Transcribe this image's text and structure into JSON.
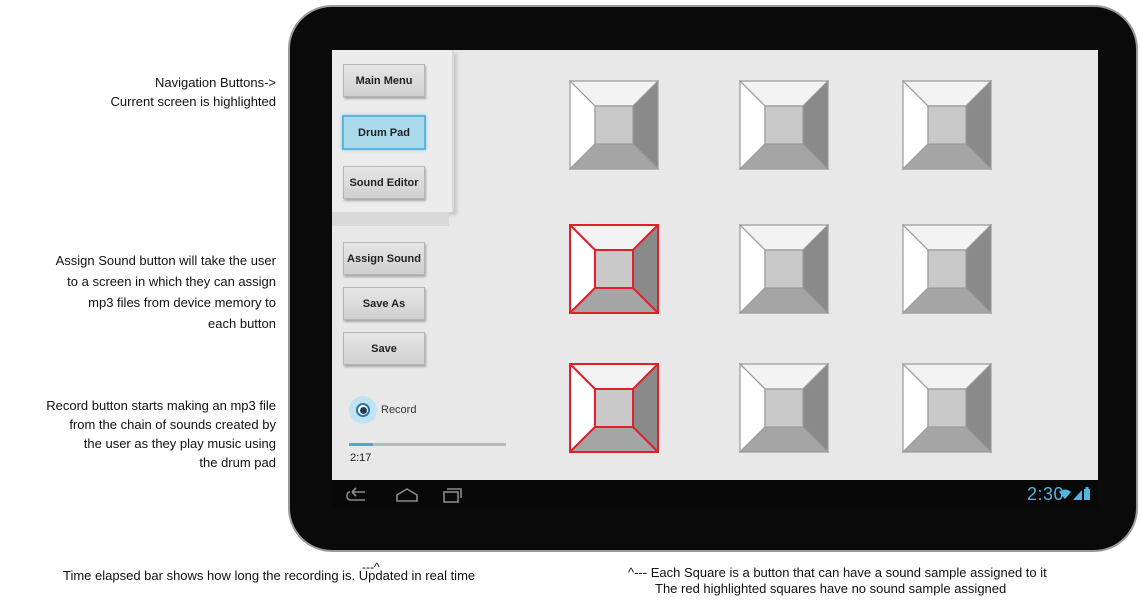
{
  "annotations": {
    "nav": [
      "Navigation Buttons->",
      "Current screen is highlighted"
    ],
    "assign": [
      "Assign Sound button will take the user",
      "to a screen in which they can assign",
      "mp3 files from device memory to",
      "each button"
    ],
    "record": [
      "Record button starts making an mp3 file",
      "from the chain of sounds created by",
      "the user as they play music using",
      "the drum pad"
    ],
    "time_arrow": "---^",
    "time": "Time elapsed bar shows how long the recording is. Updated in real time",
    "squares": [
      "^--- Each Square is a button that can have a sound sample assigned to it",
      "The red highlighted squares have no sound sample assigned"
    ]
  },
  "nav": {
    "main_menu": "Main Menu",
    "drum_pad": "Drum Pad",
    "sound_editor": "Sound Editor",
    "active": "Drum Pad"
  },
  "actions": {
    "assign_sound": "Assign Sound",
    "save_as": "Save As",
    "save": "Save"
  },
  "record": {
    "label": "Record",
    "icon": "record-icon",
    "progress": 0.15,
    "elapsed": "2:17"
  },
  "pads": {
    "rows": 3,
    "cols": 3,
    "unassigned": [
      [
        1,
        0
      ],
      [
        2,
        0
      ]
    ],
    "colors": {
      "unassigned_border": "#e0202a",
      "assigned_border": "#9a9a9a"
    }
  },
  "system_bar": {
    "clock": "2:30",
    "icons": [
      "back-icon",
      "home-icon",
      "recent-apps-icon",
      "wifi-icon",
      "signal-icon",
      "battery-icon"
    ],
    "accent": "#4fb6e0"
  }
}
